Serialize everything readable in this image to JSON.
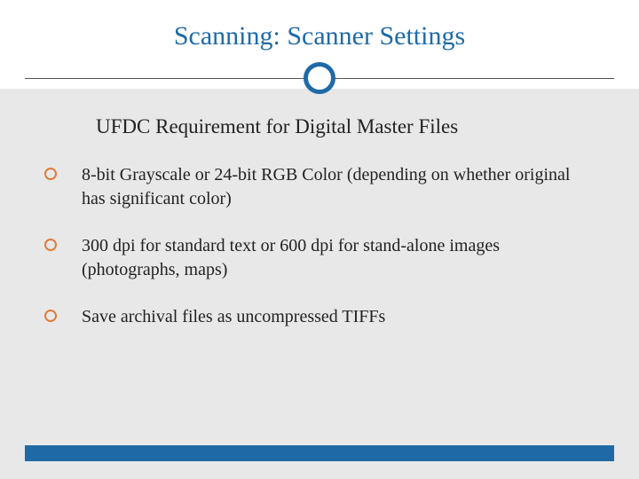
{
  "title": "Scanning: Scanner Settings",
  "subtitle": "UFDC Requirement for Digital Master Files",
  "bullets": [
    "8-bit Grayscale or 24-bit RGB Color (depending on whether original has significant color)",
    "300 dpi for standard text or 600 dpi for stand-alone images (photographs, maps)",
    "Save archival files as uncompressed TIFFs"
  ],
  "colors": {
    "accent_blue": "#1f6aa6",
    "bullet_orange": "#e07b3a",
    "content_bg": "#e8e8e8"
  }
}
